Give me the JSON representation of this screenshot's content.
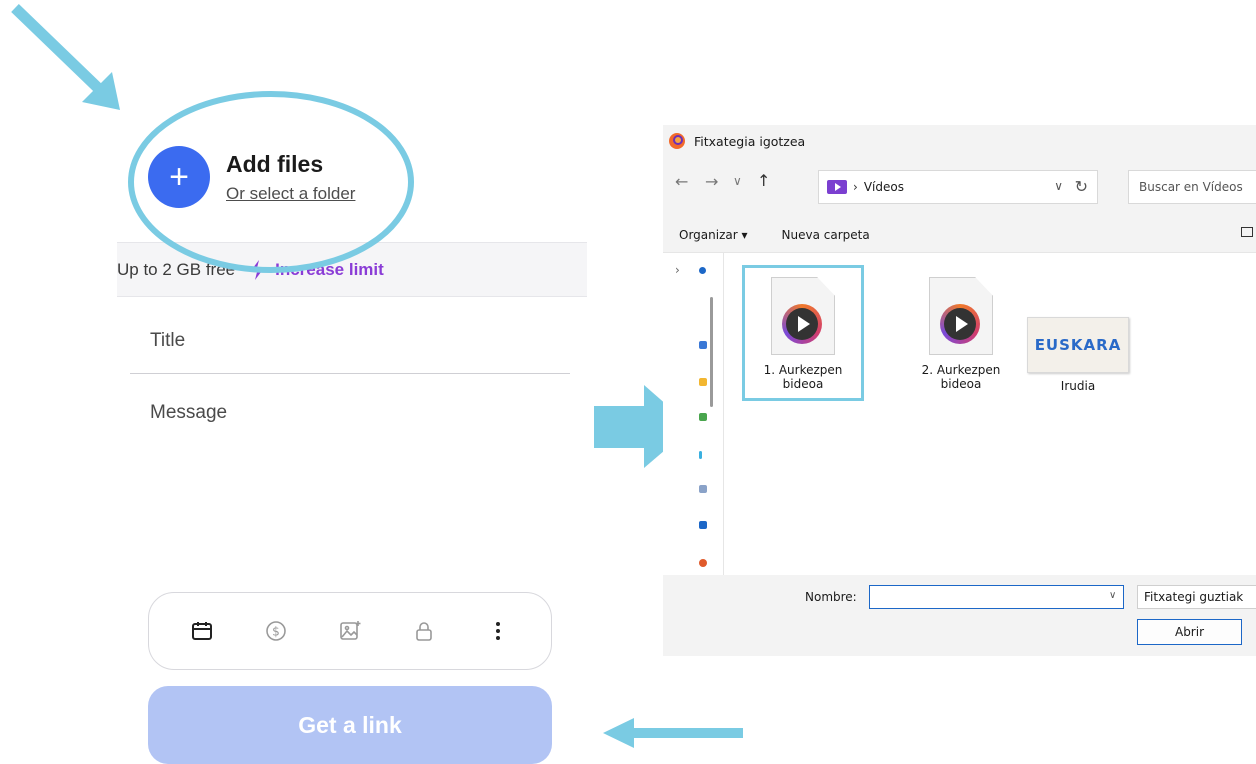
{
  "upload_panel": {
    "add_files_label": "Add files",
    "select_folder_link": "Or select a folder",
    "limit_text": "Up to 2 GB free",
    "increase_limit_link": "Increase limit",
    "title_placeholder": "Title",
    "message_placeholder": "Message",
    "get_link_button": "Get a link",
    "options_icons": [
      "calendar-icon",
      "dollar-icon",
      "image-add-icon",
      "lock-icon",
      "more-vertical-icon"
    ]
  },
  "file_dialog": {
    "title": "Fitxategia igotzea",
    "address_folder": "Vídeos",
    "search_placeholder": "Buscar en Vídeos",
    "organize_button": "Organizar",
    "new_folder_button": "Nueva carpeta",
    "files": [
      {
        "line1": "1. Aurkezpen",
        "line2": "bideoa",
        "type": "video",
        "selected": true
      },
      {
        "line1": "2. Aurkezpen",
        "line2": "bideoa",
        "type": "video",
        "selected": false
      },
      {
        "line1": "Irudia",
        "line2": "",
        "type": "image",
        "selected": false
      }
    ],
    "image_thumb_text": "EUSKARA",
    "filename_label": "Nombre:",
    "filename_value": "",
    "filetype_value": "Fitxategi guztiak",
    "open_button": "Abrir"
  },
  "colors": {
    "annotation": "#7acbe3",
    "add_button": "#3b6bf0",
    "increase_limit": "#8a3cd6",
    "get_link_disabled": "#b2c4f4"
  }
}
